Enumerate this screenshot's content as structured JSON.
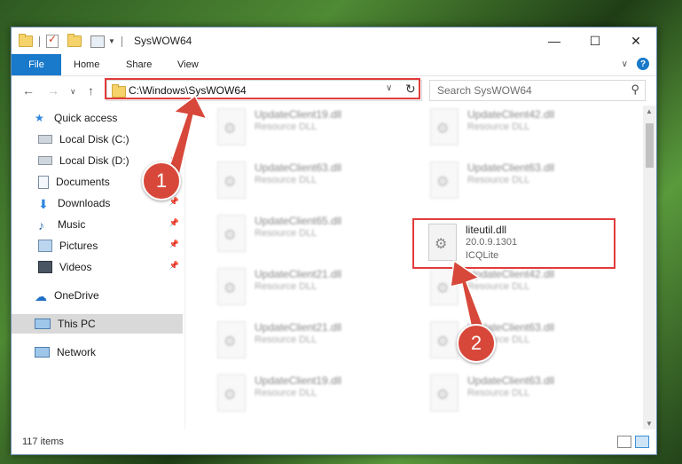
{
  "window": {
    "title": "SysWOW64"
  },
  "caption": {
    "minimize": "—",
    "maximize": "☐",
    "close": "✕"
  },
  "ribbon": {
    "file": "File",
    "home": "Home",
    "share": "Share",
    "view": "View",
    "help": "?"
  },
  "nav": {
    "back": "←",
    "forward": "→",
    "recent": "∨",
    "up": "↑"
  },
  "address": {
    "path": "C:\\Windows\\SysWOW64",
    "refresh": "↻"
  },
  "search": {
    "placeholder": "Search SysWOW64",
    "icon": "search-icon"
  },
  "sidebar": {
    "items": [
      {
        "label": "Quick access",
        "icon": "star-icon"
      },
      {
        "label": "Local Disk (C:)",
        "icon": "drive-icon"
      },
      {
        "label": "Local Disk (D:)",
        "icon": "drive-icon"
      },
      {
        "label": "Documents",
        "icon": "documents-icon"
      },
      {
        "label": "Downloads",
        "icon": "downloads-icon"
      },
      {
        "label": "Music",
        "icon": "music-icon"
      },
      {
        "label": "Pictures",
        "icon": "pictures-icon"
      },
      {
        "label": "Videos",
        "icon": "videos-icon"
      },
      {
        "label": "OneDrive",
        "icon": "cloud-icon"
      },
      {
        "label": "This PC",
        "icon": "computer-icon"
      },
      {
        "label": "Network",
        "icon": "network-icon"
      }
    ]
  },
  "files": [
    {
      "name": "UpdateClient19.dll",
      "desc": "Resource DLL"
    },
    {
      "name": "UpdateClient42.dll",
      "desc": "Resource DLL"
    },
    {
      "name": "UpdateClient63.dll",
      "desc": "Resource DLL"
    },
    {
      "name": "UpdateClient63.dll",
      "desc": "Resource DLL"
    },
    {
      "name": "UpdateClient65.dll",
      "desc": "Resource DLL"
    },
    {
      "name": "liteutil.dll",
      "desc": "20.0.9.1301",
      "company": "ICQLite"
    },
    {
      "name": "UpdateClient21.dll",
      "desc": "Resource DLL"
    },
    {
      "name": "UpdateClient42.dll",
      "desc": "Resource DLL"
    },
    {
      "name": "UpdateClient21.dll",
      "desc": "Resource DLL"
    },
    {
      "name": "UpdateClient63.dll",
      "desc": "Resource DLL"
    },
    {
      "name": "UpdateClient19.dll",
      "desc": "Resource DLL"
    },
    {
      "name": "UpdateClient63.dll",
      "desc": "Resource DLL"
    }
  ],
  "status": {
    "count": "117 items"
  },
  "annotations": {
    "step1": "1",
    "step2": "2",
    "color": "#d7483a"
  }
}
